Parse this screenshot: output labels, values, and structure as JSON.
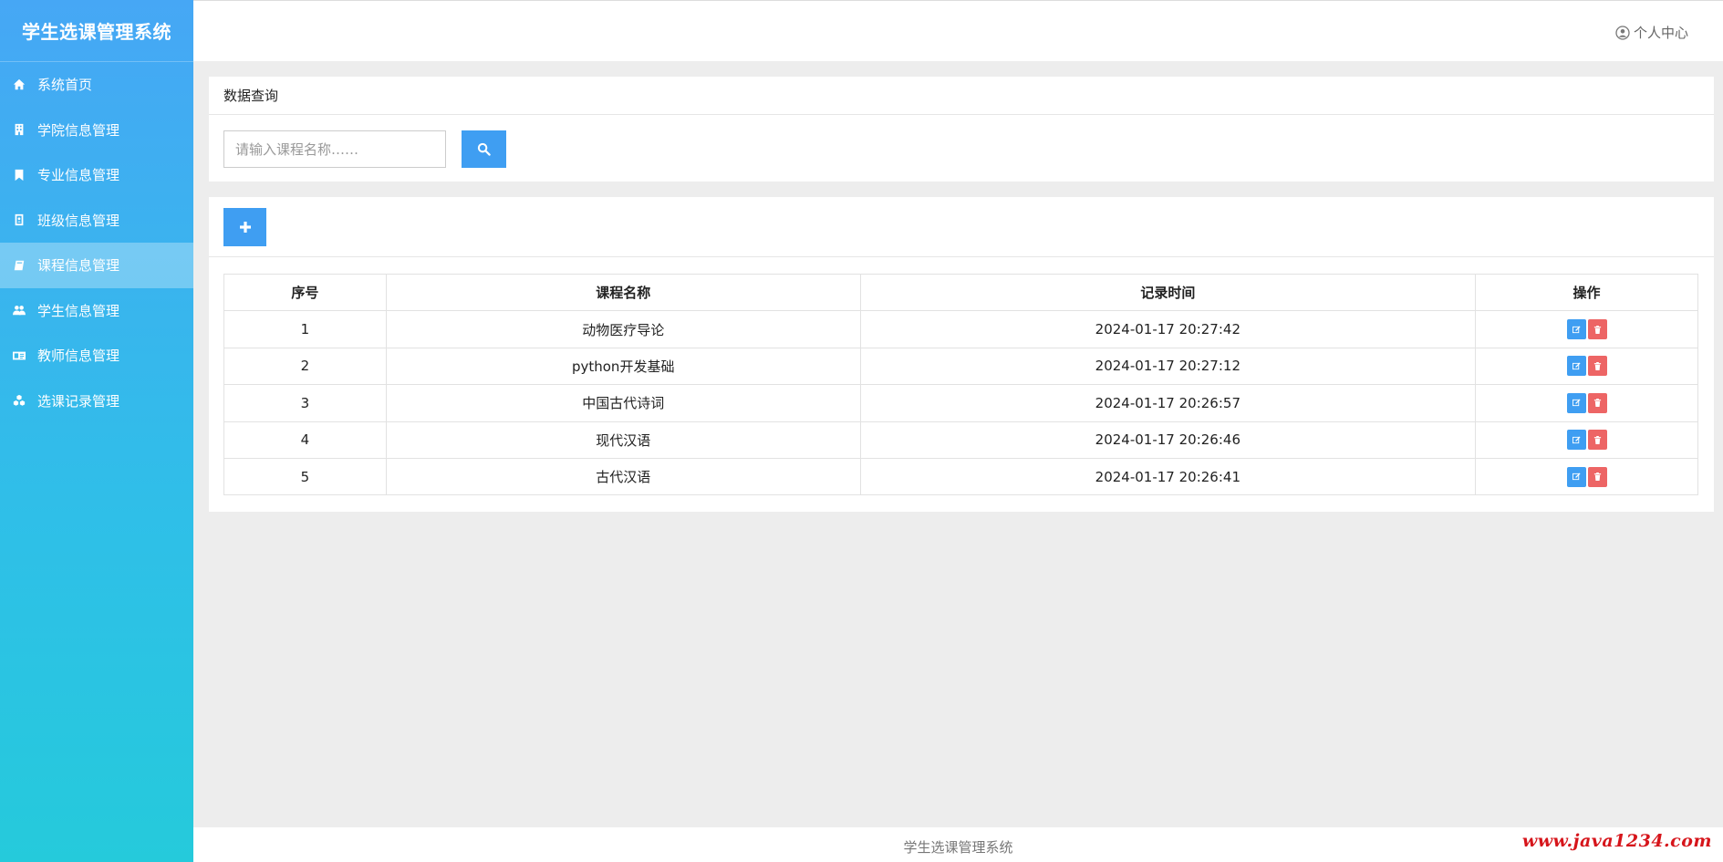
{
  "app": {
    "title": "学生选课管理系统"
  },
  "sidebar": {
    "items": [
      {
        "label": "系统首页",
        "icon": "home-icon"
      },
      {
        "label": "学院信息管理",
        "icon": "building-icon"
      },
      {
        "label": "专业信息管理",
        "icon": "bookmark-icon"
      },
      {
        "label": "班级信息管理",
        "icon": "badge-icon"
      },
      {
        "label": "课程信息管理",
        "icon": "book-icon",
        "active": true
      },
      {
        "label": "学生信息管理",
        "icon": "users-icon"
      },
      {
        "label": "教师信息管理",
        "icon": "id-card-icon"
      },
      {
        "label": "选课记录管理",
        "icon": "cubes-icon"
      }
    ]
  },
  "header": {
    "user_center": "个人中心"
  },
  "query": {
    "title": "数据查询",
    "search_placeholder": "请输入课程名称……"
  },
  "table": {
    "columns": [
      "序号",
      "课程名称",
      "记录时间",
      "操作"
    ],
    "rows": [
      {
        "index": "1",
        "name": "动物医疗导论",
        "time": "2024-01-17 20:27:42"
      },
      {
        "index": "2",
        "name": "python开发基础",
        "time": "2024-01-17 20:27:12"
      },
      {
        "index": "3",
        "name": "中国古代诗词",
        "time": "2024-01-17 20:26:57"
      },
      {
        "index": "4",
        "name": "现代汉语",
        "time": "2024-01-17 20:26:46"
      },
      {
        "index": "5",
        "name": "古代汉语",
        "time": "2024-01-17 20:26:41"
      }
    ]
  },
  "footer": {
    "text": "学生选课管理系统"
  },
  "watermark": "www.java1234.com",
  "colors": {
    "primary": "#3f9ef2",
    "danger": "#ed6565",
    "sidebar_top": "#46a7f5",
    "sidebar_bottom": "#25cadb"
  }
}
